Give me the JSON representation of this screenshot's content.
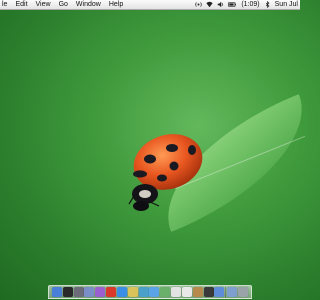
{
  "menubar": {
    "items": [
      "le",
      "Edit",
      "View",
      "Go",
      "Window",
      "Help"
    ],
    "status": {
      "battery_text": "(1:09)",
      "clock_text": "Sun Jul"
    },
    "icons": [
      "broadcast-icon",
      "wifi-icon",
      "volume-icon",
      "battery-icon",
      "bluetooth-icon"
    ]
  },
  "desktop": {
    "wallpaper": "ladybug on leaf",
    "colors": {
      "background": "#3f9a3c",
      "ladybug_shell": "#e8561f",
      "ladybug_spots": "#1b1a22"
    }
  },
  "dock": {
    "icons": [
      {
        "name": "finder-icon",
        "color": "#4a7fd8"
      },
      {
        "name": "dashboard-icon",
        "color": "#2a2a2a"
      },
      {
        "name": "system-prefs-icon",
        "color": "#6b6b7a"
      },
      {
        "name": "mail-icon",
        "color": "#7a8fc8"
      },
      {
        "name": "itunes-icon",
        "color": "#9b5fd0"
      },
      {
        "name": "reminder-icon",
        "color": "#d8392b"
      },
      {
        "name": "safari-icon",
        "color": "#3a8ee6"
      },
      {
        "name": "notes-icon",
        "color": "#d9c35a"
      },
      {
        "name": "photos-icon",
        "color": "#4aa0c8"
      },
      {
        "name": "ichat-icon",
        "color": "#59a3e6"
      },
      {
        "name": "preview-icon",
        "color": "#6ab06a"
      },
      {
        "name": "textedit-icon",
        "color": "#e2e2e2"
      },
      {
        "name": "calendar-icon",
        "color": "#e8e8e8"
      },
      {
        "name": "addressbook-icon",
        "color": "#b68a4d"
      },
      {
        "name": "terminal-icon",
        "color": "#3a3a3a"
      },
      {
        "name": "app-store-icon",
        "color": "#5f8cd8"
      },
      {
        "name": "downloads-icon",
        "color": "#7f9fcf"
      },
      {
        "name": "trash-icon",
        "color": "#9aa3a8"
      }
    ]
  }
}
